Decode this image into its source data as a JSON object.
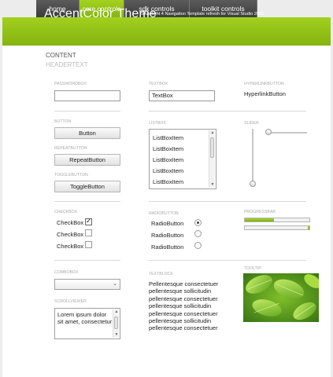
{
  "nav": {
    "tabs": [
      {
        "label": "home",
        "active": false
      },
      {
        "label": "core controls",
        "active": true
      },
      {
        "label": "sdk controls",
        "active": false
      },
      {
        "label": "toolkit controls",
        "active": false
      }
    ]
  },
  "header": {
    "title": "AccentColor Theme",
    "subtitle": "Silverlight 4 Navigation Template refresh for Visual Studio 2010"
  },
  "page": {
    "content_title": "CONTENT",
    "header_text": "HEADERTEXT"
  },
  "labels": {
    "passwordbox": "PASSWORDBOX",
    "textbox": "TEXTBOX",
    "hyperlinkbutton": "HYPERLINKBUTTON",
    "button": "BUTTON",
    "listbox": "LISTBOX",
    "slider": "SLIDER",
    "repeatbutton": "REPEATBUTTON",
    "togglebutton": "TOGGLEBUTTON",
    "checkbox": "CHECKBOX",
    "radiobutton": "RADIOBUTTON",
    "progressbar": "PROGRESSBAR",
    "combobox": "COMBOBOX",
    "textblock": "TEXTBLOCK",
    "tooltip": "TOOLTIP",
    "scrollviewer": "SCROLLVIEWER"
  },
  "controls": {
    "password_value": "",
    "textbox_value": "TextBox",
    "hyperlink_label": "HyperlinkButton",
    "button_label": "Button",
    "repeat_button_label": "RepeatButton",
    "toggle_button_label": "ToggleButton",
    "listbox_items": [
      "ListBoxItem",
      "ListBoxItem",
      "ListBoxItem",
      "ListBoxItem",
      "ListBoxItem"
    ],
    "checkboxes": [
      {
        "label": "CheckBox",
        "checked": true
      },
      {
        "label": "CheckBox",
        "checked": false
      },
      {
        "label": "CheckBox",
        "checked": false
      }
    ],
    "radios": [
      {
        "label": "RadioButton",
        "selected": true
      },
      {
        "label": "RadioButton",
        "selected": false
      },
      {
        "label": "RadioButton",
        "selected": false
      }
    ],
    "slider_horizontal_value": 0,
    "slider_vertical_value": 0,
    "progress_values": [
      0.45,
      0.03
    ],
    "combobox_value": "",
    "scrollviewer_text": "Lorem ipsum dolor sit amet, consectetur",
    "textblock_text": "Pellentesque consectetuer pellentesque sollicitudin pellentesque consectetuer pellentesque sollicitudin pellentesque consectetuer pellentesque sollicitudin pellentesque consectetuer"
  },
  "colors": {
    "accent": "#95c316",
    "nav_dark": "#4a4a4a"
  }
}
